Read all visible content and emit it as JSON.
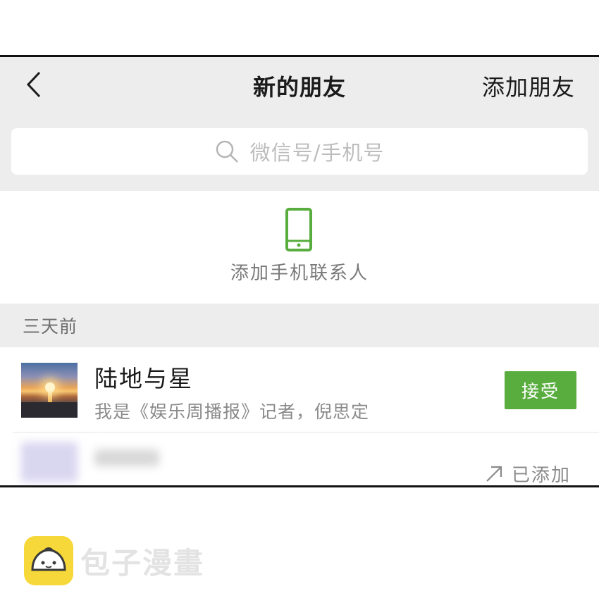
{
  "header": {
    "title": "新的朋友",
    "add_friend_label": "添加朋友"
  },
  "search": {
    "placeholder": "微信号/手机号"
  },
  "phone_contacts": {
    "label": "添加手机联系人"
  },
  "section": {
    "label": "三天前"
  },
  "requests": [
    {
      "name": "陆地与星",
      "message": "我是《娱乐周播报》记者，倪思定",
      "action_label": "接受"
    },
    {
      "status_label": "已添加"
    }
  ],
  "watermark": {
    "text": "包子漫畫"
  },
  "colors": {
    "accent_green": "#58ad3e",
    "header_bg": "#eeedee",
    "logo_yellow": "#f6d83a"
  }
}
